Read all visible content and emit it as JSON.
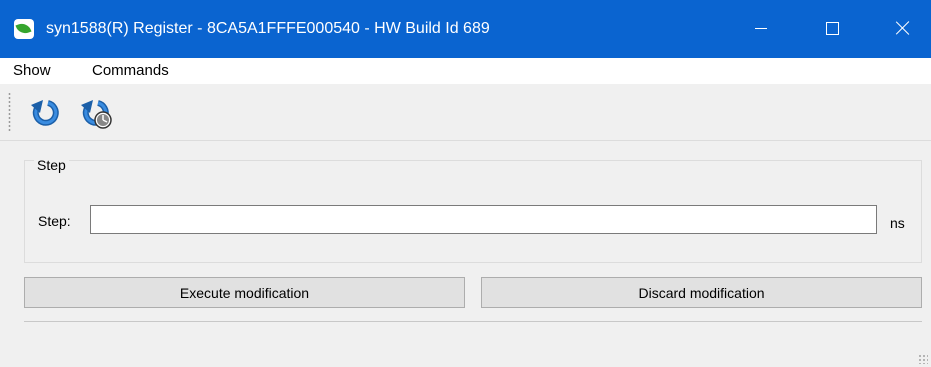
{
  "window": {
    "title": "syn1588(R) Register - 8CA5A1FFFE000540 - HW Build Id 689",
    "app_icon": "leaf-logo-icon",
    "controls": [
      "minimize-icon",
      "maximize-icon",
      "close-icon"
    ],
    "title_bar_color": "#0a64d0"
  },
  "menu": {
    "items": [
      {
        "label": "Show"
      },
      {
        "label": "Commands"
      }
    ]
  },
  "toolbar": {
    "buttons": [
      {
        "icon": "refresh-icon"
      },
      {
        "icon": "refresh-clock-icon"
      }
    ]
  },
  "step_group": {
    "title": "Step",
    "field_label": "Step:",
    "field_value": "",
    "unit": "ns"
  },
  "actions": {
    "execute_label": "Execute modification",
    "discard_label": "Discard modification"
  }
}
